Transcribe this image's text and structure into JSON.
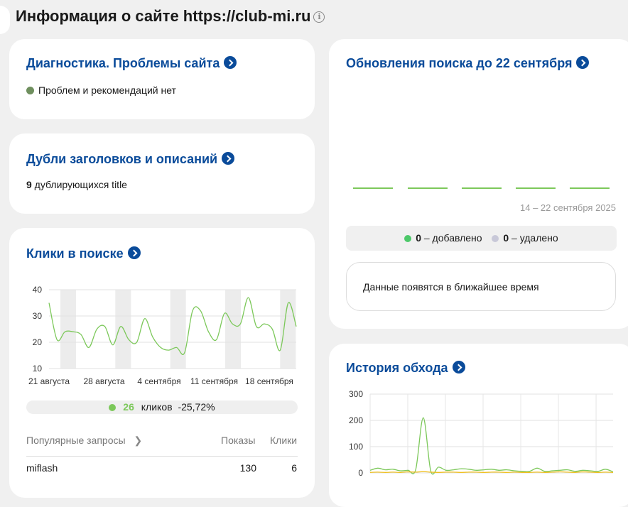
{
  "page": {
    "title": "Информация о сайте https://club-mi.ru"
  },
  "colors": {
    "accent": "#0a4b9a",
    "ok": "#6f8f5e",
    "green": "#7cc85a",
    "removed": "#c8c8d8",
    "yellow": "#f0c020"
  },
  "diagnostics": {
    "title": "Диагностика. Проблемы сайта",
    "status": "Проблем и рекомендаций нет"
  },
  "duplicates": {
    "title": "Дубли заголовков и описаний",
    "count": "9",
    "text": " дублирующихся title"
  },
  "search_updates": {
    "title": "Обновления поиска до 22 сентября",
    "range": "14 – 22 сентября 2025",
    "added_value": "0",
    "added_label": " – добавлено",
    "removed_value": "0",
    "removed_label": " – удалено",
    "notice": "Данные появятся в ближайшее время"
  },
  "clicks": {
    "title": "Клики в поиске",
    "summary_value": "26",
    "summary_label": "кликов",
    "summary_change": "-25,72%",
    "queries_header": "Популярные запросы",
    "col_shows": "Показы",
    "col_clicks": "Клики",
    "rows": [
      {
        "query": "miflash",
        "shows": "130",
        "clicks": "6"
      }
    ]
  },
  "crawl": {
    "title": "История обхода"
  },
  "chart_data": [
    {
      "type": "line",
      "title": "Клики в поиске",
      "ylim": [
        10,
        40
      ],
      "y_ticks": [
        40,
        30,
        20,
        10
      ],
      "x_ticks": [
        "21 августа",
        "28 августа",
        "4 сентября",
        "11 сентября",
        "18 сентября"
      ],
      "grid": true,
      "series": [
        {
          "color": "#7cc85a",
          "values": [
            35,
            21,
            24,
            24,
            23,
            18,
            25,
            26,
            19,
            26,
            21,
            20,
            29,
            22,
            18,
            17,
            18,
            16,
            32,
            32,
            24,
            21,
            31,
            27,
            27,
            37,
            26,
            27,
            25,
            17,
            35,
            26
          ]
        }
      ]
    },
    {
      "type": "line",
      "title": "История обхода",
      "ylim": [
        0,
        300
      ],
      "y_ticks": [
        300,
        200,
        100,
        0
      ],
      "grid": true,
      "series": [
        {
          "color": "#7cc85a",
          "values": [
            10,
            18,
            12,
            14,
            8,
            10,
            12,
            210,
            6,
            22,
            10,
            12,
            16,
            14,
            10,
            12,
            14,
            10,
            12,
            8,
            6,
            6,
            18,
            6,
            8,
            10,
            12,
            6,
            10,
            8,
            6,
            14,
            4
          ]
        },
        {
          "color": "#f0c020",
          "values": [
            2,
            3,
            2,
            3,
            2,
            4,
            3,
            5,
            3,
            2,
            3,
            3,
            2,
            3,
            3,
            2,
            3,
            3,
            2,
            3,
            2,
            2,
            3,
            2,
            3,
            4,
            3,
            2,
            4,
            3,
            2,
            3,
            2
          ]
        }
      ]
    }
  ]
}
